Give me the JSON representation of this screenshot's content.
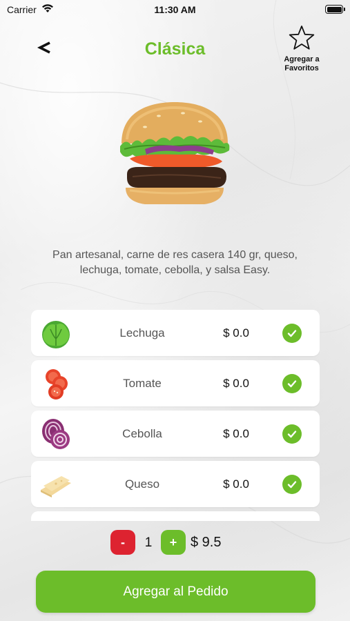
{
  "status_bar": {
    "carrier": "Carrier",
    "time": "11:30 AM"
  },
  "header": {
    "back_label": "<",
    "title": "Clásica",
    "favorite_label_line1": "Agregar a",
    "favorite_label_line2": "Favoritos"
  },
  "product": {
    "description": "Pan artesanal, carne de res casera 140 gr, queso, lechuga, tomate, cebolla, y salsa Easy.",
    "image_icon": "burger-image"
  },
  "ingredients": [
    {
      "name": "Lechuga",
      "price": "$ 0.0",
      "checked": true,
      "icon": "lettuce-icon"
    },
    {
      "name": "Tomate",
      "price": "$ 0.0",
      "checked": true,
      "icon": "tomato-icon"
    },
    {
      "name": "Cebolla",
      "price": "$ 0.0",
      "checked": true,
      "icon": "onion-icon"
    },
    {
      "name": "Queso",
      "price": "$ 0.0",
      "checked": true,
      "icon": "cheese-icon"
    }
  ],
  "order": {
    "minus_label": "-",
    "plus_label": "+",
    "quantity": "1",
    "total": "$ 9.5",
    "add_button_label": "Agregar al Pedido"
  },
  "colors": {
    "accent_green": "#6cbd2a",
    "minus_red": "#dd2330"
  }
}
